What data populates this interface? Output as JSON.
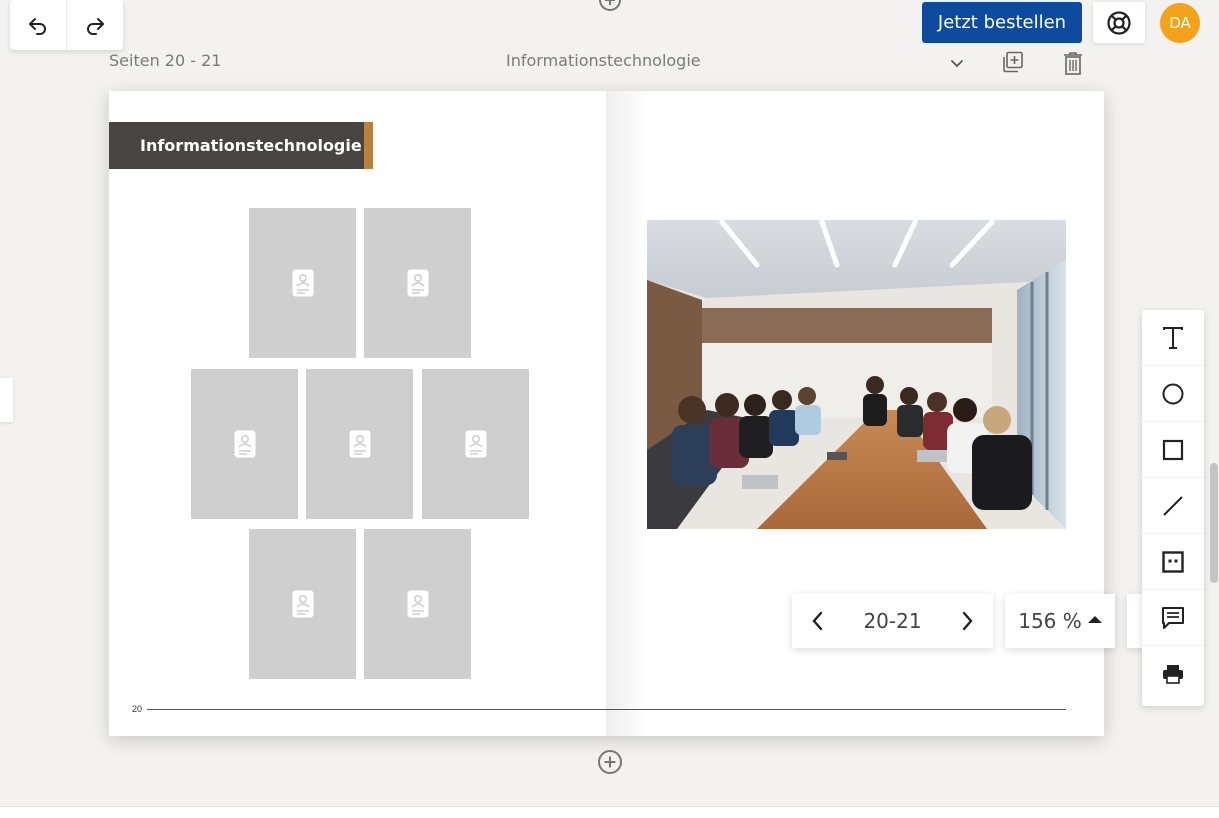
{
  "toolbar": {
    "undo_icon": "undo-icon",
    "redo_icon": "redo-icon"
  },
  "header": {
    "order_label": "Jetzt bestellen",
    "help_icon": "lifebuoy-icon",
    "avatar_initials": "DA",
    "avatar_color": "#f5a21b",
    "order_color": "#0e4a9e"
  },
  "spread": {
    "pages_label": "Seiten 20 - 21",
    "title": "Informationstechnologie",
    "left_page": {
      "heading": "Informationstechnologie",
      "page_number": "20",
      "photo_slots": 7
    },
    "right_page": {
      "image": "meeting-photo"
    }
  },
  "navigation": {
    "pages": "20-21",
    "zoom": "156 %"
  },
  "tools": [
    "text-tool",
    "circle-tool",
    "rectangle-tool",
    "line-tool",
    "placeholder-tool",
    "comment-tool",
    "print-tool"
  ],
  "colors": {
    "title_box": "#474443",
    "title_accent": "#b9813f",
    "slot": "#cfcfcf"
  }
}
